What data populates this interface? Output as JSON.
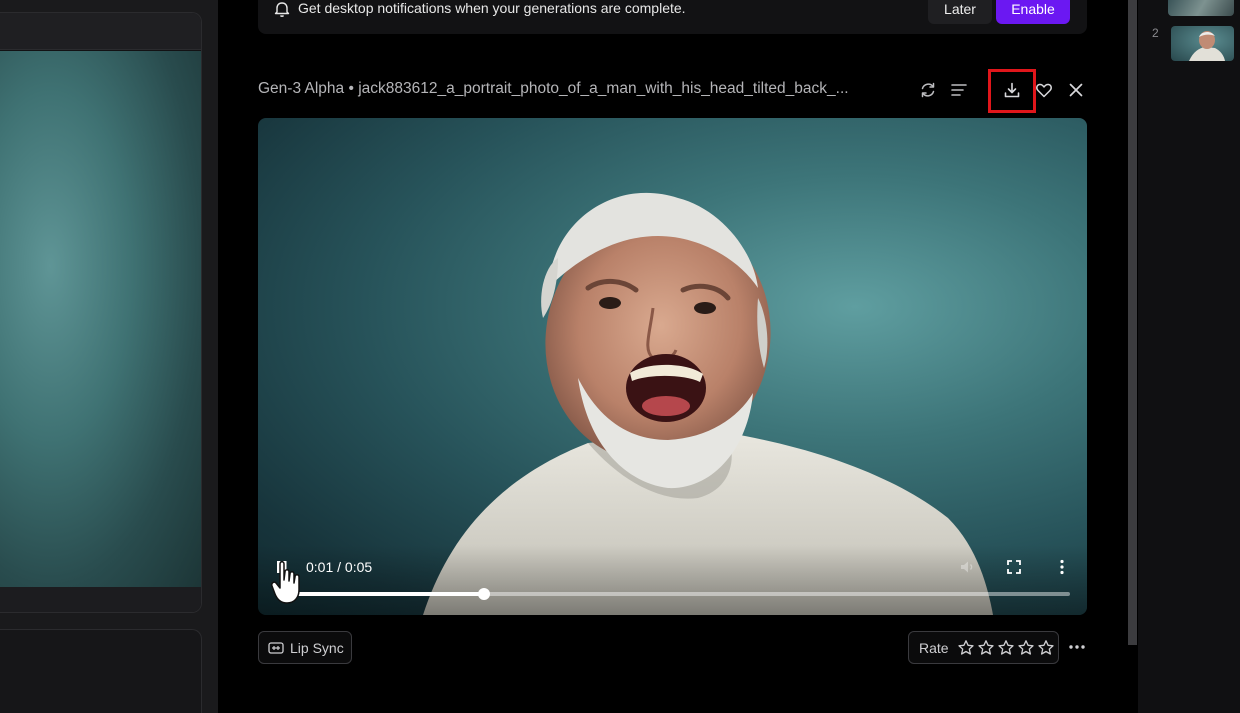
{
  "notification": {
    "text": "Get desktop notifications when your generations are complete.",
    "later_label": "Later",
    "enable_label": "Enable"
  },
  "generation": {
    "title": "Gen-3 Alpha • jack883612_a_portrait_photo_of_a_man_with_his_head_tilted_back_..."
  },
  "toolbar_icons": [
    "refresh-icon",
    "details-icon",
    "download-icon",
    "favorite-icon",
    "close-icon"
  ],
  "player": {
    "time": "0:01 / 0:05",
    "progress": 0.26
  },
  "actions": {
    "lip_sync_label": "Lip Sync",
    "rate_label": "Rate",
    "star_count": 5
  },
  "right_rail": {
    "item_number": "2"
  },
  "colors": {
    "accent": "#6b18f2",
    "highlight": "#e0161b"
  }
}
